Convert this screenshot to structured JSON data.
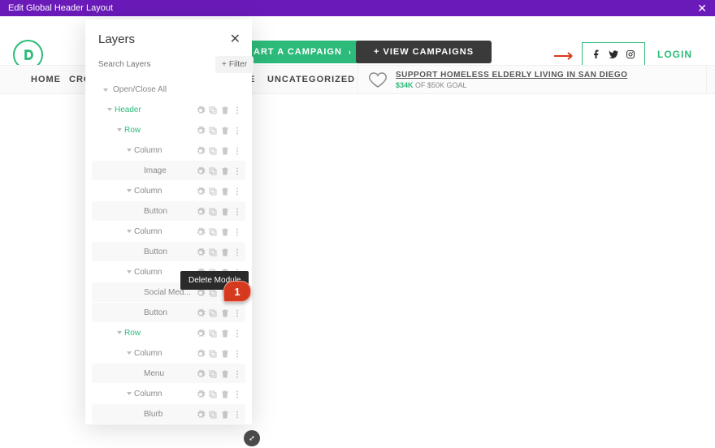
{
  "topbar": {
    "title": "Edit Global Header Layout",
    "close": "✕"
  },
  "header": {
    "start_campaign": "ART A CAMPAIGN",
    "view_campaigns": "+ VIEW CAMPAIGNS",
    "login": "LOGIN"
  },
  "nav": {
    "home": "HOME",
    "cro": "CRO",
    "e": "E",
    "uncategorized": "UNCATEGORIZED"
  },
  "campaign": {
    "title": "SUPPORT HOMELESS ELDERLY LIVING IN SAN DIEGO",
    "amount": "$34K",
    "goal_rest": " OF $50K GOAL"
  },
  "layers": {
    "title": "Layers",
    "search_placeholder": "Search Layers",
    "filter": "Filter",
    "open_close_all": "Open/Close All",
    "items": {
      "header": "Header",
      "row": "Row",
      "column": "Column",
      "image": "Image",
      "button": "Button",
      "social": "Social Med...",
      "menu": "Menu",
      "blurb": "Blurb"
    }
  },
  "tooltip": "Delete Module",
  "callout": "1"
}
